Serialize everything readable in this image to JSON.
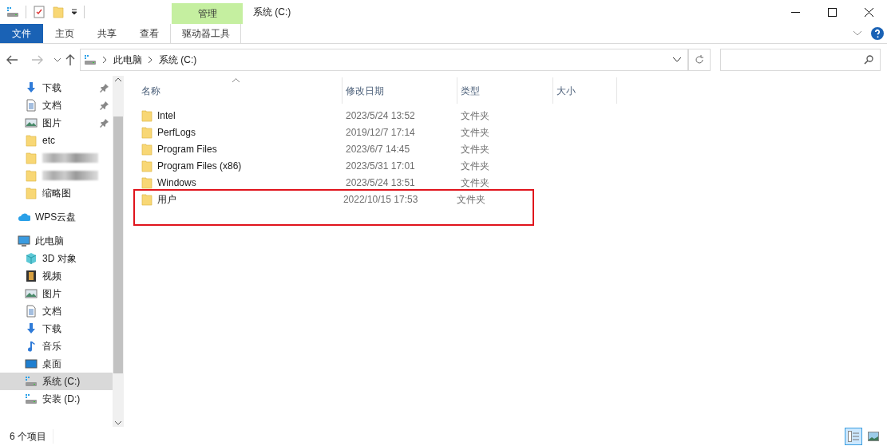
{
  "window": {
    "title": "系统 (C:)",
    "contextual_tab": "管理"
  },
  "ribbon_tabs": [
    {
      "label": "文件",
      "kind": "file",
      "selected": false
    },
    {
      "label": "主页",
      "kind": "tab",
      "selected": false
    },
    {
      "label": "共享",
      "kind": "tab",
      "selected": false
    },
    {
      "label": "查看",
      "kind": "tab",
      "selected": false
    },
    {
      "label": "驱动器工具",
      "kind": "contextual",
      "selected": false
    }
  ],
  "address_bar": {
    "path": [
      "此电脑",
      "系统 (C:)"
    ]
  },
  "sidebar": {
    "items": [
      {
        "label": "下载",
        "kind": "download",
        "pinned": true,
        "selected": false
      },
      {
        "label": "文档",
        "kind": "document",
        "pinned": true,
        "selected": false
      },
      {
        "label": "图片",
        "kind": "picture",
        "pinned": true,
        "selected": false
      },
      {
        "label": "etc",
        "kind": "folder",
        "pinned": false,
        "selected": false
      },
      {
        "kind": "redacted",
        "pinned": false,
        "selected": false
      },
      {
        "kind": "redacted",
        "pinned": false,
        "selected": false
      },
      {
        "label": "缩略图",
        "kind": "folder",
        "pinned": false,
        "selected": false
      },
      {
        "label": "WPS云盘",
        "kind": "cloud",
        "selected": false
      },
      {
        "label": "此电脑",
        "kind": "computer",
        "selected": false,
        "children": [
          {
            "label": "3D 对象",
            "kind": "cube",
            "selected": false
          },
          {
            "label": "视频",
            "kind": "film",
            "selected": false
          },
          {
            "label": "图片",
            "kind": "picture",
            "selected": false
          },
          {
            "label": "文档",
            "kind": "document",
            "selected": false
          },
          {
            "label": "下载",
            "kind": "download",
            "selected": false
          },
          {
            "label": "音乐",
            "kind": "music",
            "selected": false
          },
          {
            "label": "桌面",
            "kind": "desktop",
            "selected": false
          },
          {
            "label": "系统 (C:)",
            "kind": "drive",
            "selected": true
          },
          {
            "label": "安装 (D:)",
            "kind": "drive",
            "selected": false
          }
        ]
      }
    ]
  },
  "table": {
    "columns": [
      {
        "label": "名称",
        "sorted": true
      },
      {
        "label": "修改日期"
      },
      {
        "label": "类型"
      },
      {
        "label": "大小"
      }
    ],
    "rows": [
      {
        "name": "Intel",
        "modified": "2023/5/24 13:52",
        "type": "文件夹",
        "highlighted": false
      },
      {
        "name": "PerfLogs",
        "modified": "2019/12/7 17:14",
        "type": "文件夹",
        "highlighted": false
      },
      {
        "name": "Program Files",
        "modified": "2023/6/7 14:45",
        "type": "文件夹",
        "highlighted": false
      },
      {
        "name": "Program Files (x86)",
        "modified": "2023/5/31 17:01",
        "type": "文件夹",
        "highlighted": false
      },
      {
        "name": "Windows",
        "modified": "2023/5/24 13:51",
        "type": "文件夹",
        "highlighted": false
      },
      {
        "name": "用户",
        "modified": "2022/10/15 17:53",
        "type": "文件夹",
        "highlighted": true
      }
    ]
  },
  "status_bar": {
    "item_count": "6 个项目",
    "view_buttons": [
      {
        "kind": "details",
        "selected": true
      },
      {
        "kind": "thumbnails",
        "selected": false
      }
    ]
  }
}
